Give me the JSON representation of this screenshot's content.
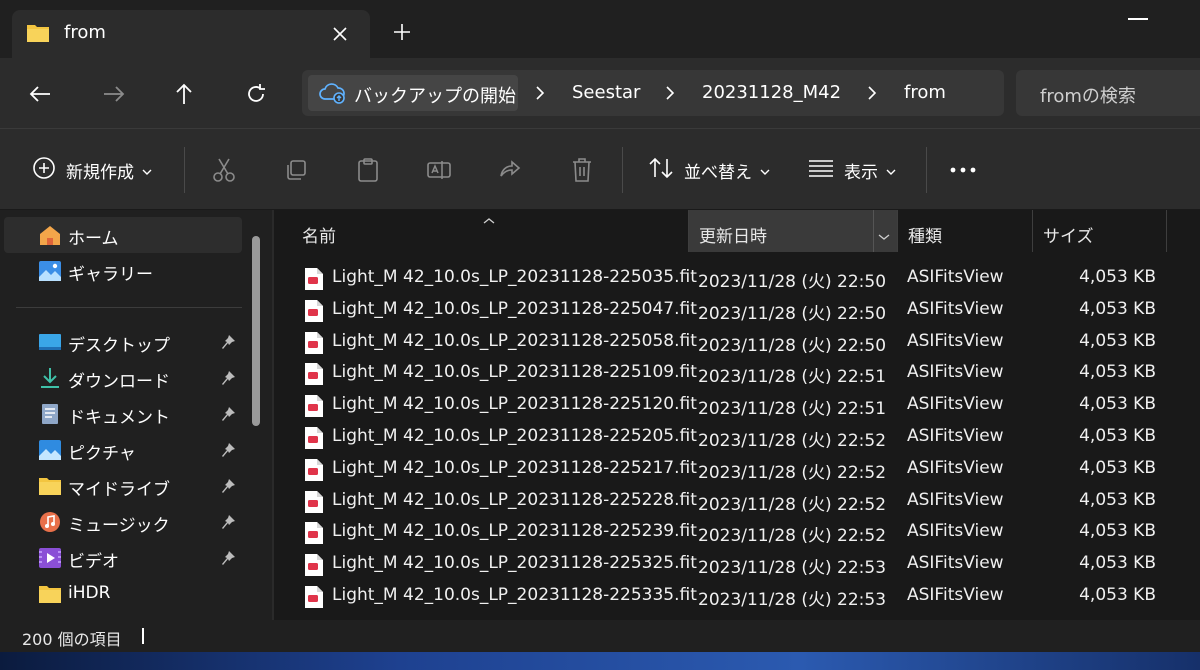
{
  "window": {
    "tab_title": "from",
    "search_placeholder": "fromの検索"
  },
  "address": {
    "backup_label": "バックアップの開始",
    "crumbs": [
      "Seestar",
      "20231128_M42",
      "from"
    ]
  },
  "command_bar": {
    "new_label": "新規作成",
    "sort_label": "並べ替え",
    "view_label": "表示"
  },
  "sidebar": {
    "items": [
      {
        "label": "ホーム",
        "icon": "home-icon"
      },
      {
        "label": "ギャラリー",
        "icon": "gallery-icon"
      },
      {
        "label": "デスクトップ",
        "icon": "desktop-icon"
      },
      {
        "label": "ダウンロード",
        "icon": "download-icon"
      },
      {
        "label": "ドキュメント",
        "icon": "documents-icon"
      },
      {
        "label": "ピクチャ",
        "icon": "pictures-icon"
      },
      {
        "label": "マイドライブ",
        "icon": "folder-icon"
      },
      {
        "label": "ミュージック",
        "icon": "music-icon"
      },
      {
        "label": "ビデオ",
        "icon": "video-icon"
      },
      {
        "label": "iHDR",
        "icon": "folder-icon"
      }
    ]
  },
  "columns": {
    "name": "名前",
    "date": "更新日時",
    "type": "種類",
    "size": "サイズ"
  },
  "files": [
    {
      "name": "Light_M 42_10.0s_LP_20231128-225035.fit",
      "date": "2023/11/28 (火) 22:50",
      "type": "ASIFitsView",
      "size": "4,053 KB"
    },
    {
      "name": "Light_M 42_10.0s_LP_20231128-225047.fit",
      "date": "2023/11/28 (火) 22:50",
      "type": "ASIFitsView",
      "size": "4,053 KB"
    },
    {
      "name": "Light_M 42_10.0s_LP_20231128-225058.fit",
      "date": "2023/11/28 (火) 22:50",
      "type": "ASIFitsView",
      "size": "4,053 KB"
    },
    {
      "name": "Light_M 42_10.0s_LP_20231128-225109.fit",
      "date": "2023/11/28 (火) 22:51",
      "type": "ASIFitsView",
      "size": "4,053 KB"
    },
    {
      "name": "Light_M 42_10.0s_LP_20231128-225120.fit",
      "date": "2023/11/28 (火) 22:51",
      "type": "ASIFitsView",
      "size": "4,053 KB"
    },
    {
      "name": "Light_M 42_10.0s_LP_20231128-225205.fit",
      "date": "2023/11/28 (火) 22:52",
      "type": "ASIFitsView",
      "size": "4,053 KB"
    },
    {
      "name": "Light_M 42_10.0s_LP_20231128-225217.fit",
      "date": "2023/11/28 (火) 22:52",
      "type": "ASIFitsView",
      "size": "4,053 KB"
    },
    {
      "name": "Light_M 42_10.0s_LP_20231128-225228.fit",
      "date": "2023/11/28 (火) 22:52",
      "type": "ASIFitsView",
      "size": "4,053 KB"
    },
    {
      "name": "Light_M 42_10.0s_LP_20231128-225239.fit",
      "date": "2023/11/28 (火) 22:52",
      "type": "ASIFitsView",
      "size": "4,053 KB"
    },
    {
      "name": "Light_M 42_10.0s_LP_20231128-225325.fit",
      "date": "2023/11/28 (火) 22:53",
      "type": "ASIFitsView",
      "size": "4,053 KB"
    },
    {
      "name": "Light_M 42_10.0s_LP_20231128-225335.fit",
      "date": "2023/11/28 (火) 22:53",
      "type": "ASIFitsView",
      "size": "4,053 KB"
    }
  ],
  "status": {
    "count_text": "200 個の項目"
  },
  "colors": {
    "window_bg": "#191919",
    "bar_bg": "#2c2c2c",
    "folder_yellow": "#f3c540",
    "fit_icon_red": "#e0344a"
  }
}
